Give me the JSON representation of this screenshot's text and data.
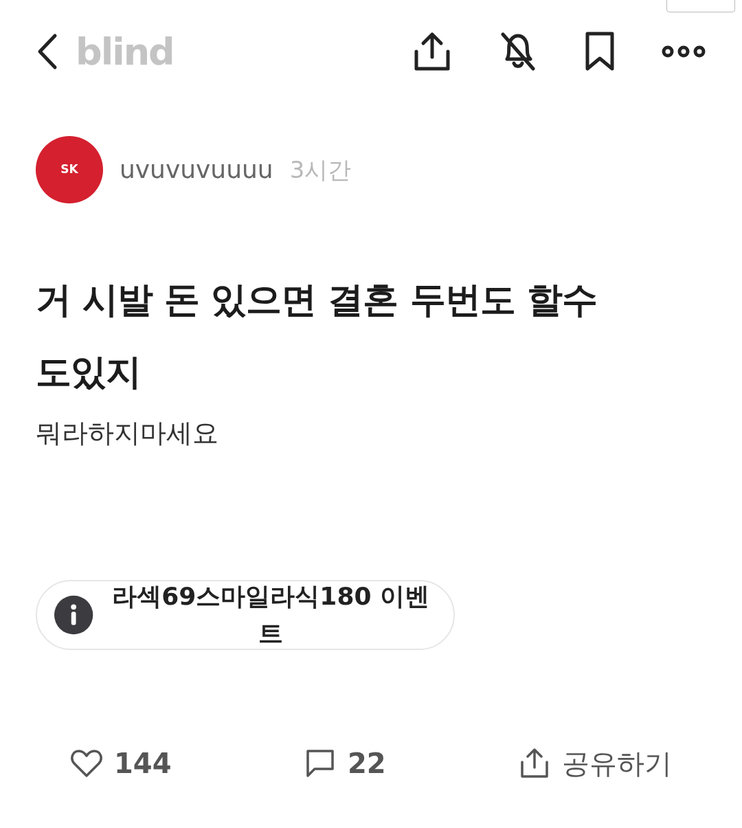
{
  "header": {
    "logo": "blind"
  },
  "post": {
    "avatar_label": "SK",
    "author": "uvuvuvuuuu",
    "time": "3시간",
    "title": "거 시발 돈 있으면 결혼 두번도 할수도있지",
    "body": "뭐라하지마세요"
  },
  "ad_chip": {
    "text": "라섹69스마일라식180 이벤트"
  },
  "actions": [
    {
      "kind": "like",
      "label": "144"
    },
    {
      "kind": "comment",
      "label": "22"
    },
    {
      "kind": "share",
      "label": "공유하기"
    }
  ]
}
